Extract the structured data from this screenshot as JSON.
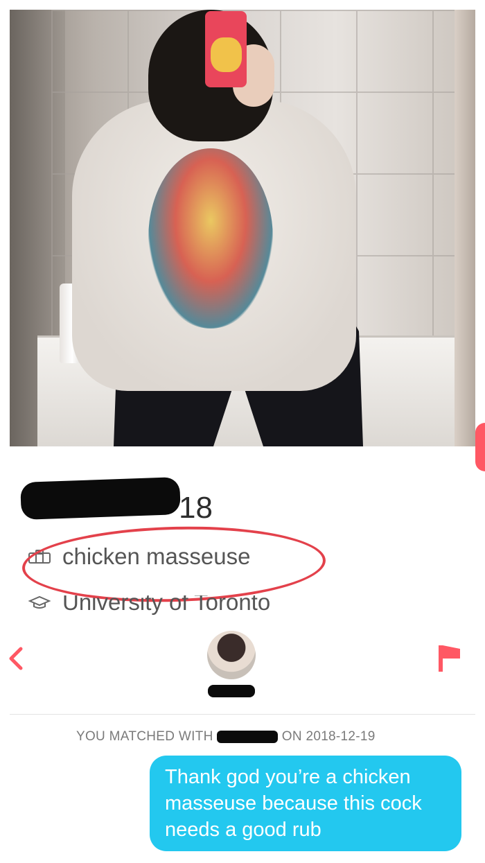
{
  "profile": {
    "age": "18",
    "job": "chicken masseuse",
    "school": "University of Toronto"
  },
  "match": {
    "banner": "YOU MATCHED WITH ",
    "date_text": "ON 2018-12-19"
  },
  "message": {
    "text": "Thank god you’re a chicken masseuse because this cock needs a good rub"
  },
  "colors": {
    "accent": "#ff5864",
    "bubble": "#23c8ef",
    "annotation_circle": "#e3414b"
  },
  "icons": {
    "back": "chevron-left-icon",
    "report": "flag-icon",
    "job": "briefcase-icon",
    "school": "graduation-cap-icon"
  }
}
